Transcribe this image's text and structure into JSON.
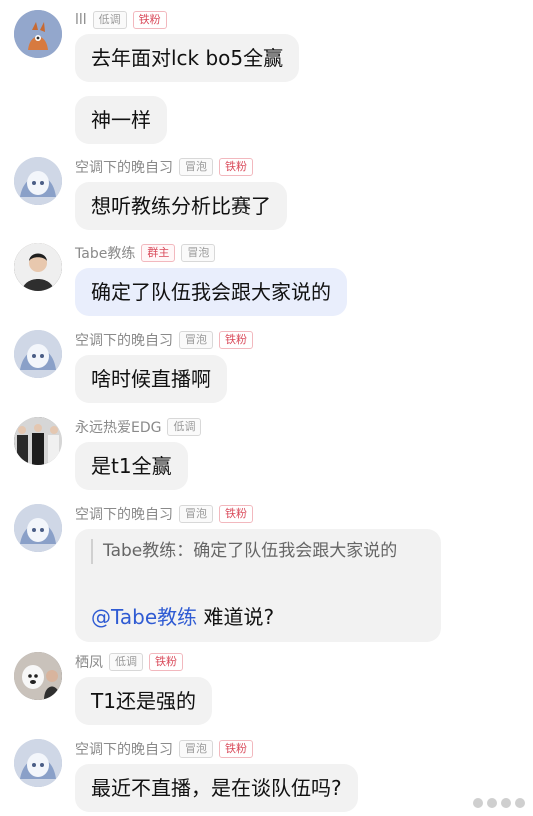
{
  "chat": {
    "m1": {
      "name": "lll",
      "badges": [
        "低调",
        "铁粉"
      ],
      "bubbles": [
        "去年面对lck bo5全赢",
        "神一样"
      ]
    },
    "m2": {
      "name": "空调下的晚自习",
      "badges": [
        "冒泡",
        "铁粉"
      ],
      "bubble": "想听教练分析比赛了"
    },
    "m3": {
      "name": "Tabe教练",
      "badges": [
        "群主",
        "冒泡"
      ],
      "bubble": "确定了队伍我会跟大家说的"
    },
    "m4": {
      "name": "空调下的晚自习",
      "badges": [
        "冒泡",
        "铁粉"
      ],
      "bubble": "啥时候直播啊"
    },
    "m5": {
      "name": "永远热爱EDG",
      "badges": [
        "低调"
      ],
      "bubble": "是t1全赢"
    },
    "m6": {
      "name": "空调下的晚自习",
      "badges": [
        "冒泡",
        "铁粉"
      ],
      "quote": "Tabe教练：确定了队伍我会跟大家说的",
      "mention": "@Tabe教练",
      "reply": "难道说?"
    },
    "m7": {
      "name": "栖凤",
      "badges": [
        "低调",
        "铁粉"
      ],
      "bubble": "T1还是强的"
    },
    "m8": {
      "name": "空调下的晚自习",
      "badges": [
        "冒泡",
        "铁粉"
      ],
      "bubble": "最近不直播，是在谈队伍吗?"
    }
  },
  "icons": {
    "avatar_fox": "fox-avatar",
    "avatar_anime": "anime-avatar",
    "avatar_man": "man-avatar",
    "avatar_group": "group-photo-avatar",
    "avatar_dog": "dog-avatar",
    "watermark": "watermark-logo"
  },
  "colors": {
    "bubble_gray": "#f2f2f2",
    "bubble_blue": "#e9eefc",
    "badge_red": "#d94a5a",
    "mention_blue": "#2f5bd3"
  }
}
